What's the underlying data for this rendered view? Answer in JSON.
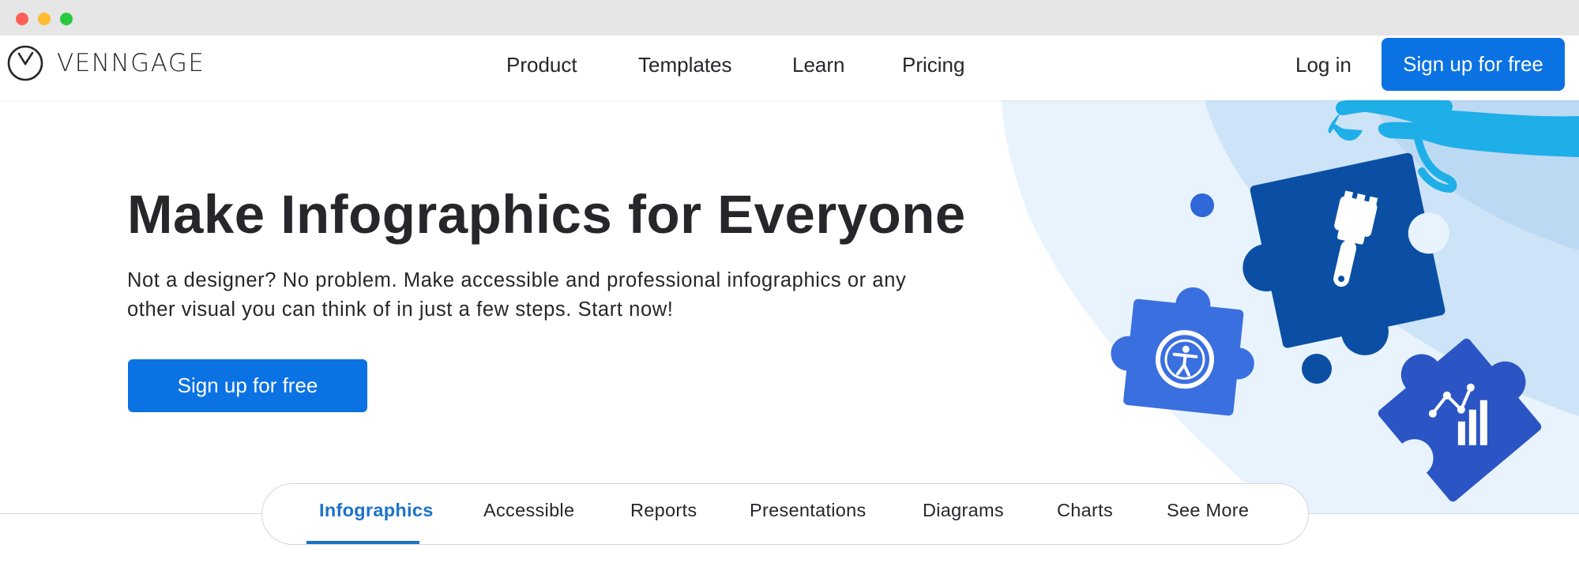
{
  "window": {
    "controls": [
      "close",
      "minimize",
      "maximize"
    ]
  },
  "navbar": {
    "logo_text": "VENNGAGE",
    "links": [
      {
        "label": "Product"
      },
      {
        "label": "Templates"
      },
      {
        "label": "Learn"
      },
      {
        "label": "Pricing"
      }
    ],
    "login_label": "Log in",
    "signup_label": "Sign up for free"
  },
  "hero": {
    "headline": "Make Infographics for Everyone",
    "subtitle": "Not a designer? No problem. Make accessible and professional infographics or any other visual you can think of in just a few steps. Start now!",
    "cta_label": "Sign up for free",
    "illustration_icons": [
      "paintbrush-icon",
      "accessibility-icon",
      "chart-icon",
      "hand-illustration"
    ]
  },
  "tabs": {
    "items": [
      {
        "label": "Infographics",
        "active": true
      },
      {
        "label": "Accessible",
        "active": false
      },
      {
        "label": "Reports",
        "active": false
      },
      {
        "label": "Presentations",
        "active": false
      },
      {
        "label": "Diagrams",
        "active": false
      },
      {
        "label": "Charts",
        "active": false
      },
      {
        "label": "See More",
        "active": false
      }
    ]
  },
  "colors": {
    "primary": "#0b72e3",
    "active_tab": "#1a73c8",
    "text": "#26262b",
    "puzzle_dark": "#0a4fa3",
    "puzzle_mid": "#2b5ec9",
    "puzzle_light": "#3a6fe0",
    "hand": "#1eaee8",
    "bg_blob_light": "#e8f3fd",
    "bg_blob_mid": "#cde3f7"
  }
}
